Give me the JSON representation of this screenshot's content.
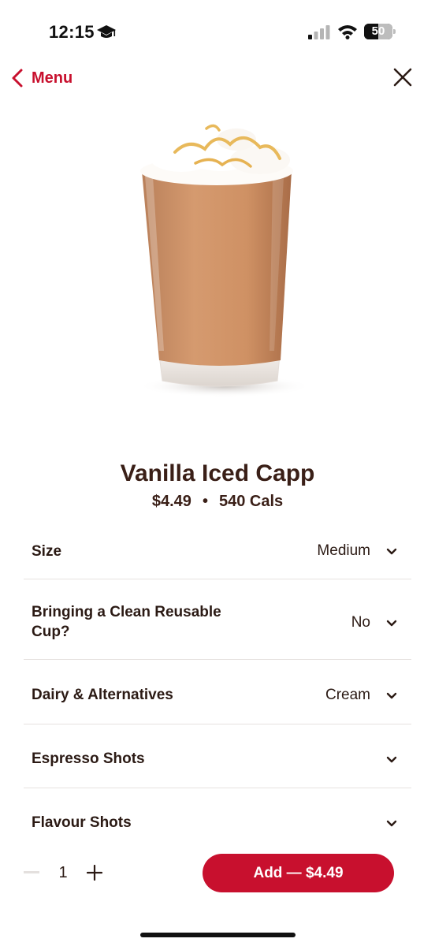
{
  "status_bar": {
    "time": "12:15",
    "battery": "50",
    "battery_level": 0.5,
    "icons": [
      "graduation-cap-icon",
      "signal-icon",
      "wifi-icon",
      "battery-icon"
    ]
  },
  "nav": {
    "back_label": "Menu",
    "back_icon": "chevron-left-icon",
    "close_icon": "close-icon"
  },
  "colors": {
    "brand_red": "#c8102e",
    "text_brown": "#3a1f17"
  },
  "product": {
    "name": "Vanilla Iced Capp",
    "price": "$4.49",
    "separator": "•",
    "calories": "540 Cals"
  },
  "options": [
    {
      "label": "Size",
      "value": "Medium"
    },
    {
      "label": "Bringing a Clean Reusable Cup?",
      "value": "No"
    },
    {
      "label": "Dairy & Alternatives",
      "value": "Cream"
    },
    {
      "label": "Espresso Shots",
      "value": ""
    },
    {
      "label": "Flavour Shots",
      "value": ""
    }
  ],
  "cart": {
    "quantity": "1",
    "add_label": "Add — $4.49"
  }
}
